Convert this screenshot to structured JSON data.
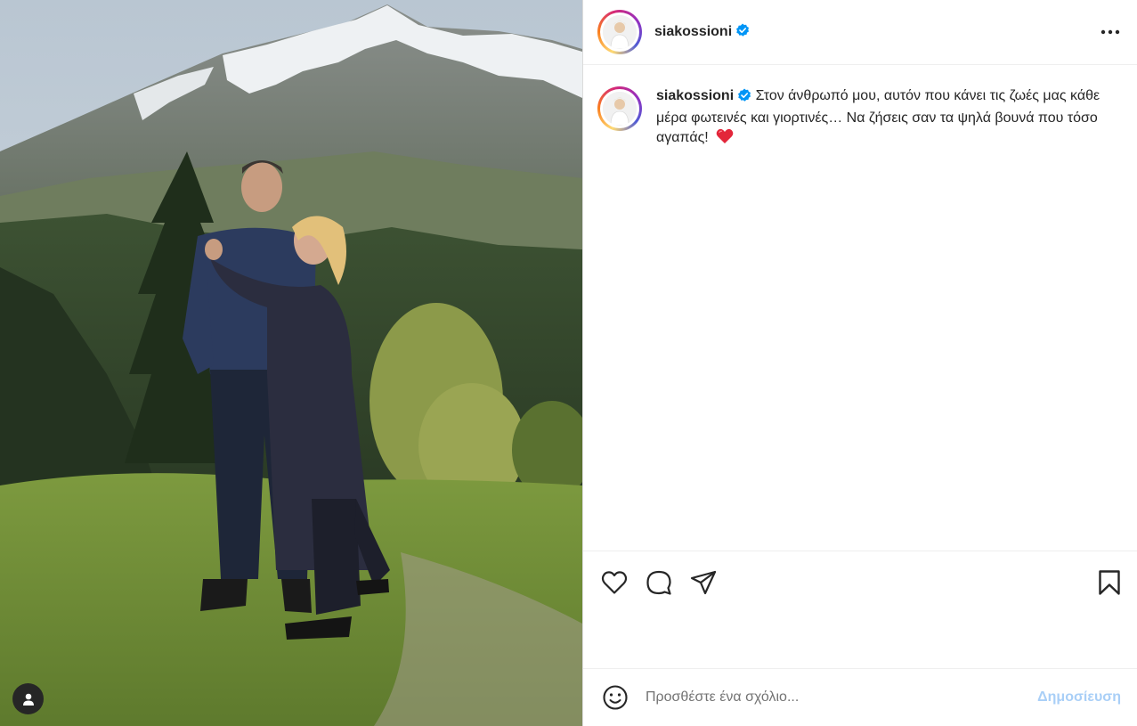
{
  "post": {
    "username": "siakossioni",
    "verified": true,
    "caption": "Στον άνθρωπό μου, αυτόν που κάνει τις ζωές μας κάθε μέρα φωτεινές και γιορτινές… Να ζήσεις σαν τα ψηλά βουνά που τόσο αγαπάς!",
    "caption_emoji": "red-heart"
  },
  "comment_box": {
    "placeholder": "Προσθέστε ένα σχόλιο...",
    "post_label": "Δημοσίευση"
  },
  "icons": {
    "verified": "verified-badge-icon",
    "more": "more-options-icon",
    "like": "heart-outline-icon",
    "comment": "comment-bubble-icon",
    "share": "paper-plane-icon",
    "save": "bookmark-icon",
    "emoji": "smiley-face-icon",
    "tag": "user-tag-icon"
  },
  "colors": {
    "verified_blue": "#0095f6",
    "post_button": "#a9cff7",
    "text": "#262626",
    "heart_red": "#e3263a"
  }
}
